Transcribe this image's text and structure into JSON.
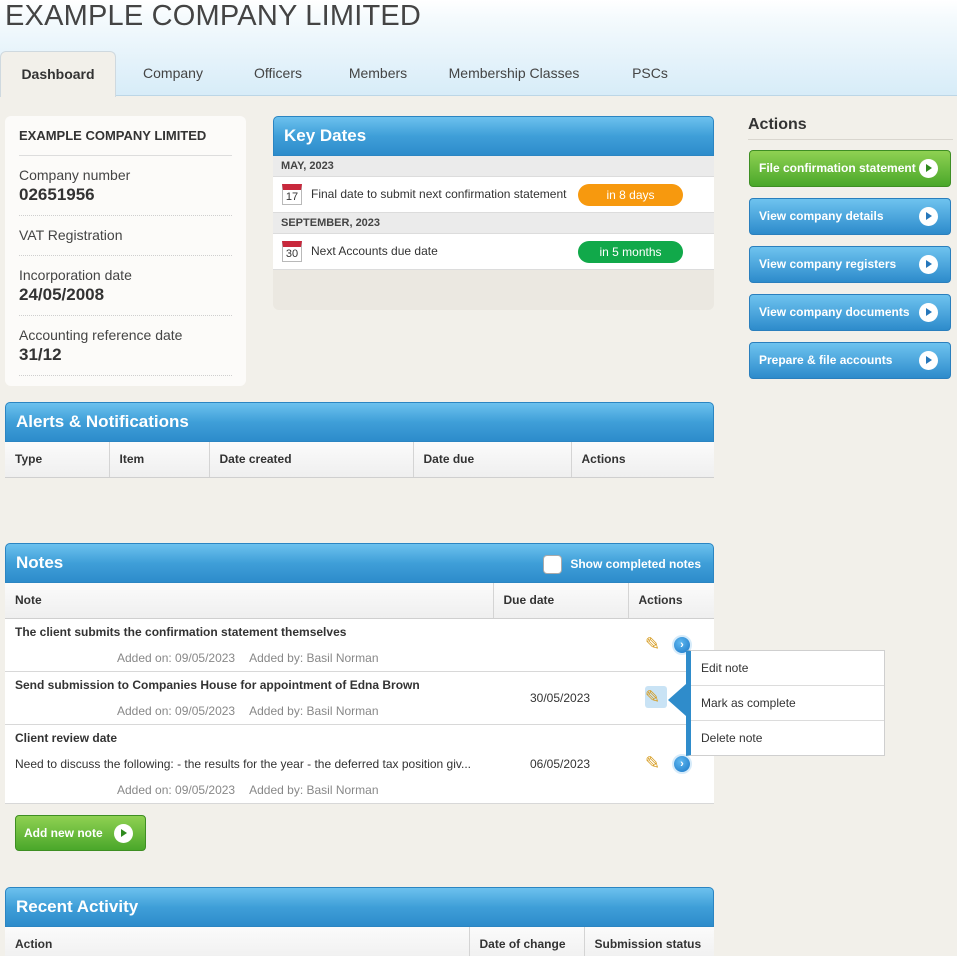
{
  "header": {
    "company_title": "EXAMPLE COMPANY LIMITED",
    "tabs": [
      {
        "label": "Dashboard",
        "active": true
      },
      {
        "label": "Company"
      },
      {
        "label": "Officers"
      },
      {
        "label": "Members"
      },
      {
        "label": "Membership Classes"
      },
      {
        "label": "PSCs"
      }
    ]
  },
  "info": {
    "company_name": "EXAMPLE COMPANY LIMITED",
    "rows": [
      {
        "label": "Company number",
        "value": "02651956"
      },
      {
        "label": "VAT Registration",
        "value": ""
      },
      {
        "label": "Incorporation date",
        "value": "24/05/2008"
      },
      {
        "label": "Accounting reference date",
        "value": "31/12"
      }
    ]
  },
  "key_dates": {
    "title": "Key Dates",
    "groups": [
      {
        "month": "MAY, 2023",
        "day": "17",
        "text": "Final date to submit next confirmation statement",
        "badge": "in 8 days",
        "badge_color": "#f7990e"
      },
      {
        "month": "SEPTEMBER, 2023",
        "day": "30",
        "text": "Next Accounts due date",
        "badge": "in 5 months",
        "badge_color": "#11a94a"
      }
    ]
  },
  "alerts": {
    "title": "Alerts & Notifications",
    "columns": [
      "Type",
      "Item",
      "Date created",
      "Date due",
      "Actions"
    ]
  },
  "notes": {
    "title": "Notes",
    "show_completed_label": "Show completed notes",
    "columns": [
      "Note",
      "Due date",
      "Actions"
    ],
    "rows": [
      {
        "title": "The client submits the confirmation statement themselves",
        "description": "",
        "due": "",
        "added_on": "Added on: 09/05/2023",
        "added_by": "Added by: Basil Norman"
      },
      {
        "title": "Send submission to Companies House for appointment of Edna Brown",
        "description": "",
        "due": "30/05/2023",
        "added_on": "Added on: 09/05/2023",
        "added_by": "Added by: Basil Norman"
      },
      {
        "title": "Client review date",
        "description": "Need to discuss the following: - the results for the year - the deferred tax position giv...",
        "due": "06/05/2023",
        "added_on": "Added on: 09/05/2023",
        "added_by": "Added by: Basil Norman"
      }
    ],
    "add_button": "Add new note",
    "menu": [
      "Edit note",
      "Mark as complete",
      "Delete note"
    ]
  },
  "activity": {
    "title": "Recent Activity",
    "columns": [
      "Action",
      "Date of change",
      "Submission status"
    ]
  },
  "actions": {
    "title": "Actions",
    "buttons": [
      {
        "label": "File confirmation statement",
        "color": "green"
      },
      {
        "label": "View company details",
        "color": "blue"
      },
      {
        "label": "View company registers",
        "color": "blue"
      },
      {
        "label": "View company documents",
        "color": "blue"
      },
      {
        "label": "Prepare & file accounts",
        "color": "blue"
      }
    ]
  }
}
